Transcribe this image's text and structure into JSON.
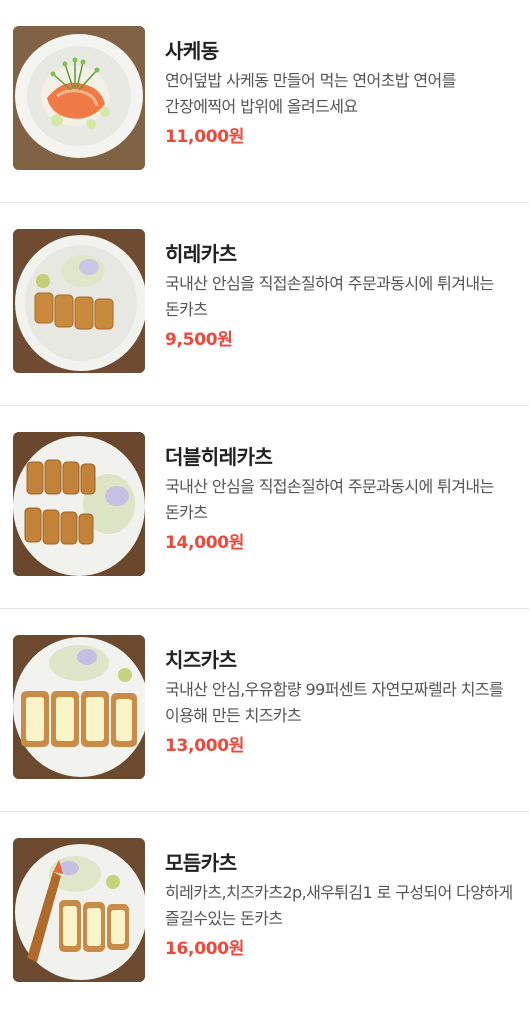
{
  "menu": {
    "items": [
      {
        "name": "사케동",
        "description": "연어덮밥 사케동 만들어 먹는 연어초밥 연어를 간장에찍어 밥위에 올려드세요",
        "price": "11,000원",
        "image_icon": "salmon-rice-bowl-image"
      },
      {
        "name": "히레카츠",
        "description": "국내산 안심을 직접손질하여 주문과동시에 튀겨내는 돈카츠",
        "price": "9,500원",
        "image_icon": "hire-katsu-image"
      },
      {
        "name": "더블히레카츠",
        "description": "국내산 안심을 직접손질하여 주문과동시에 튀겨내는 돈카츠",
        "price": "14,000원",
        "image_icon": "double-hire-katsu-image"
      },
      {
        "name": "치즈카츠",
        "description": "국내산 안심,우유함량 99퍼센트 자연모짜렐라 치즈를 이용해 만든 치즈카츠",
        "price": "13,000원",
        "image_icon": "cheese-katsu-image"
      },
      {
        "name": "모듬카츠",
        "description": "히레카츠,치즈카츠2p,새우튀김1 로 구성되어 다양하게 즐길수있는 돈카츠",
        "price": "16,000원",
        "image_icon": "assorted-katsu-image"
      }
    ],
    "colors": {
      "price": "#f0473b",
      "name": "#222222",
      "description": "#555555",
      "divider": "#e6e6e6"
    }
  }
}
